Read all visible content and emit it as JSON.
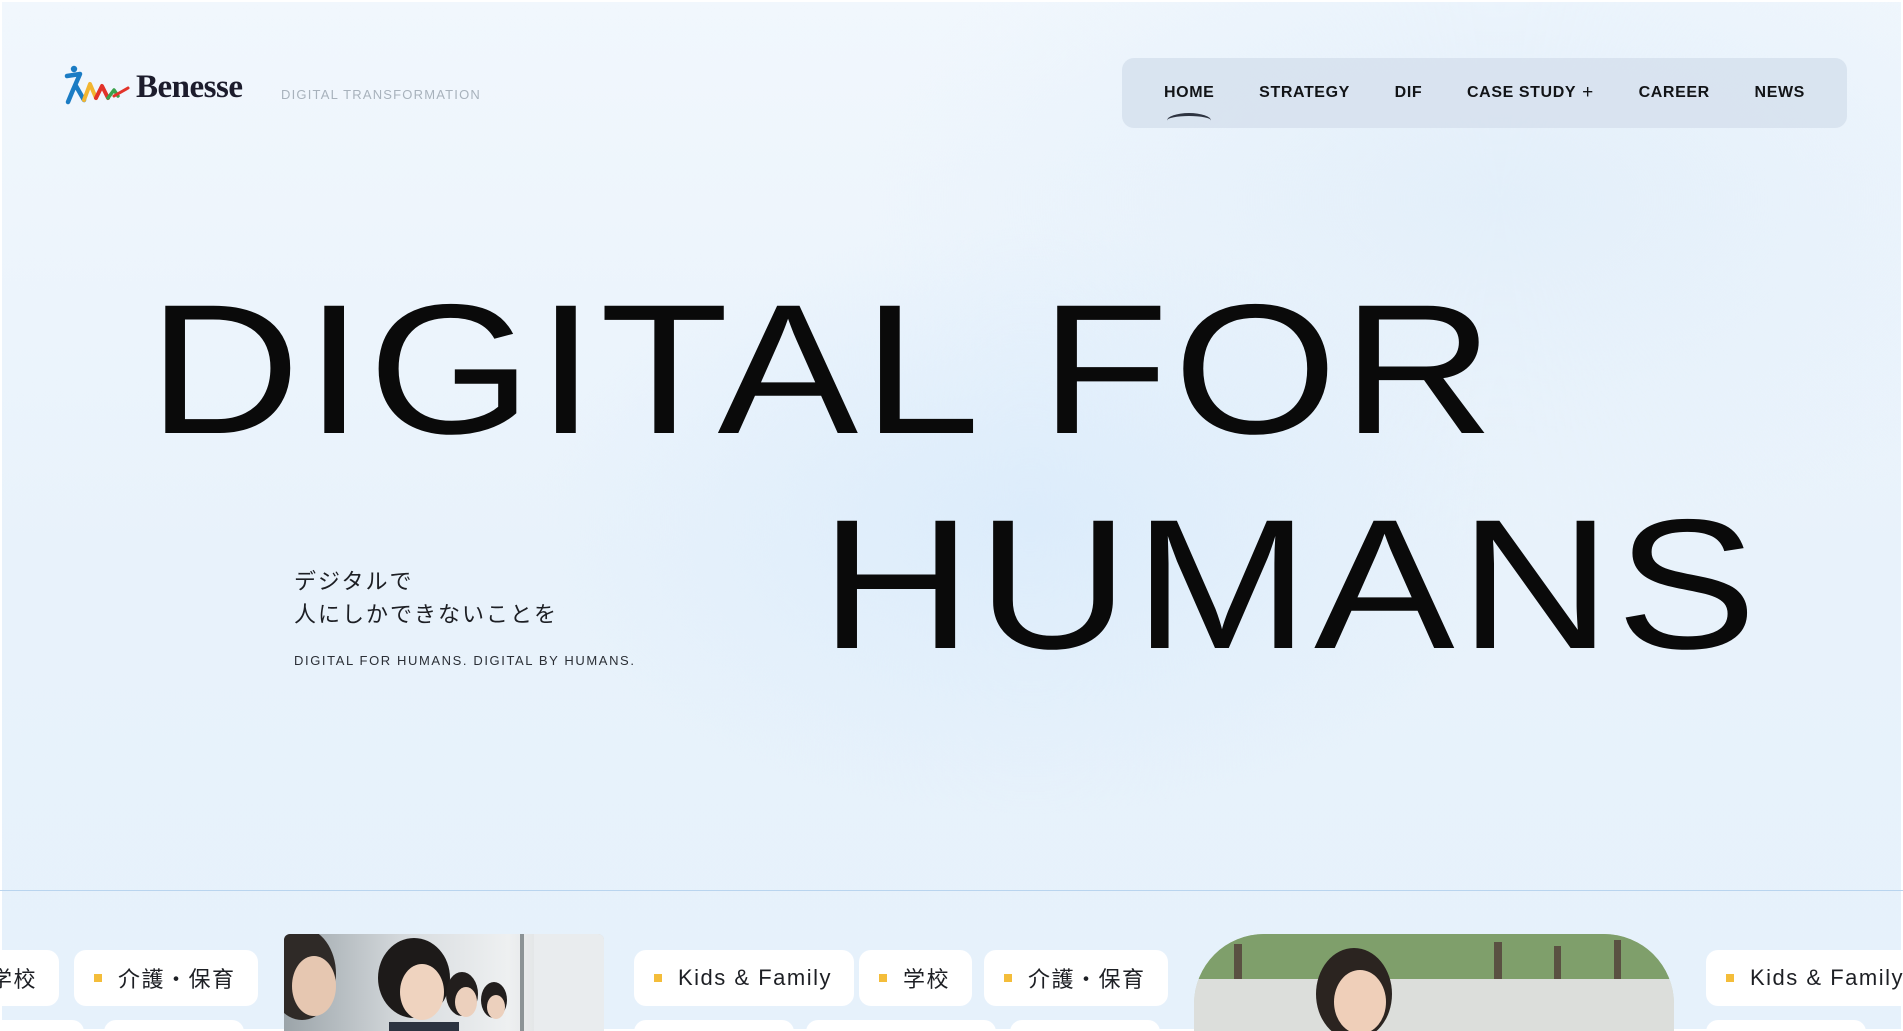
{
  "header": {
    "logo_text": "Benesse",
    "tagline": "DIGITAL TRANSFORMATION"
  },
  "nav": {
    "items": [
      {
        "label": "HOME"
      },
      {
        "label": "STRATEGY"
      },
      {
        "label": "DIF"
      },
      {
        "label": "CASE STUDY",
        "suffix": "+"
      },
      {
        "label": "CAREER"
      },
      {
        "label": "NEWS"
      }
    ]
  },
  "hero": {
    "line1": "DIGITAL FOR",
    "line2": "HUMANS",
    "jp_line1": "デジタルで",
    "jp_line2": "人にしかできないことを",
    "en_copy": "DIGITAL FOR HUMANS. DIGITAL BY HUMANS."
  },
  "ticker": {
    "items": [
      {
        "label": "学校",
        "cut": true
      },
      {
        "label": "介護・保育"
      },
      {
        "label": "Kids & Family"
      },
      {
        "label": "学校"
      },
      {
        "label": "介護・保育"
      },
      {
        "label": "Kids & Family"
      }
    ]
  },
  "colors": {
    "accent_dot": "#f4bd3a",
    "nav_bg": "#d6e1ed",
    "divider": "#b9d4ee",
    "logo_blue": "#1b7cc4",
    "logo_red": "#e2332a",
    "logo_yellow": "#f2b531",
    "logo_green": "#3aa24b"
  }
}
